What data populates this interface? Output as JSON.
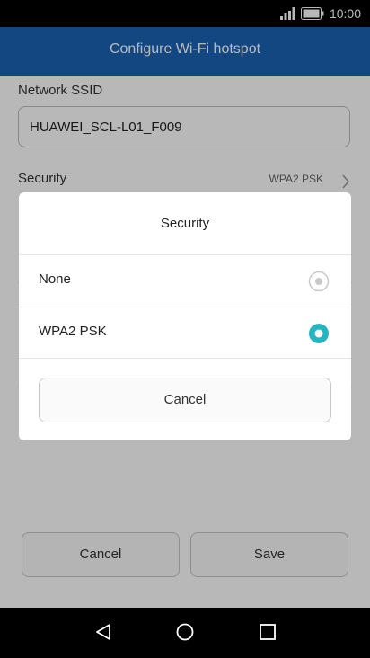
{
  "status_bar": {
    "time": "10:00",
    "icons": [
      "signal-icon",
      "battery-icon"
    ]
  },
  "header": {
    "title": "Configure Wi-Fi hotspot"
  },
  "form": {
    "ssid_label": "Network SSID",
    "ssid_value": "HUAWEI_SCL-L01_F009",
    "security_label": "Security",
    "security_value": "WPA2 PSK"
  },
  "footer": {
    "cancel_label": "Cancel",
    "save_label": "Save"
  },
  "dialog": {
    "title": "Security",
    "options": [
      {
        "label": "None",
        "selected": false
      },
      {
        "label": "WPA2 PSK",
        "selected": true
      }
    ],
    "cancel_label": "Cancel"
  },
  "nav_bar": {
    "icons": [
      "back-icon",
      "home-icon",
      "recents-icon"
    ]
  },
  "colors": {
    "header": "#1b63b5",
    "accent": "#26b5bf"
  }
}
